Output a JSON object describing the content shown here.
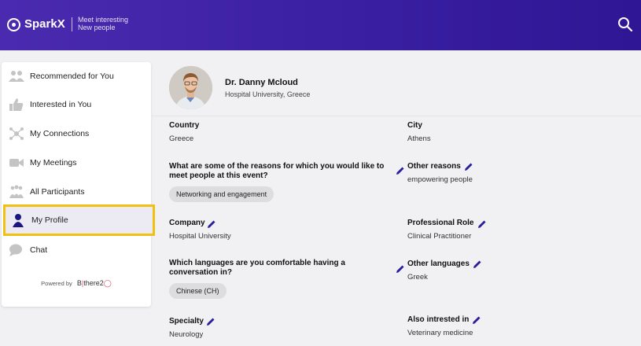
{
  "header": {
    "brand": "SparkX",
    "tagline_line1": "Meet interesting",
    "tagline_line2": "New people"
  },
  "sidebar": {
    "items": [
      {
        "label": "Recommended for You",
        "icon": "people-group-icon"
      },
      {
        "label": "Interested in You",
        "icon": "thumbs-up-icon"
      },
      {
        "label": "My Connections",
        "icon": "network-icon"
      },
      {
        "label": "My Meetings",
        "icon": "video-camera-icon"
      },
      {
        "label": "All Participants",
        "icon": "participants-icon"
      },
      {
        "label": "My Profile",
        "icon": "person-icon"
      },
      {
        "label": "Chat",
        "icon": "chat-bubble-icon"
      }
    ],
    "powered_by": "Powered by",
    "powered_brand_a": "B",
    "powered_brand_b": "there2"
  },
  "profile": {
    "name": "Dr. Danny Mcloud",
    "affiliation": "Hospital University, Greece"
  },
  "fields": {
    "country": {
      "label": "Country",
      "value": "Greece"
    },
    "city": {
      "label": "City",
      "value": "Athens"
    },
    "reasons": {
      "label": "What are some of the reasons for which you would like to meet people at this event?",
      "chip": "Networking and engagement"
    },
    "other_reasons": {
      "label": "Other reasons",
      "value": "empowering people"
    },
    "company": {
      "label": "Company",
      "value": "Hospital University"
    },
    "role": {
      "label": "Professional Role",
      "value": "Clinical Practitioner"
    },
    "languages": {
      "label": "Which languages are you comfortable having a conversation in?",
      "chip": "Chinese (CH)"
    },
    "other_languages": {
      "label": "Other languages",
      "value": "Greek"
    },
    "specialty": {
      "label": "Specialty",
      "value": "Neurology"
    },
    "also_interested": {
      "label": "Also intrested in",
      "value": "Veterinary medicine"
    }
  },
  "colors": {
    "header": "#3a1fa2",
    "active_border": "#f2c10f",
    "pencil": "#2a1e9c",
    "icon_gray": "#b9b9b9"
  }
}
